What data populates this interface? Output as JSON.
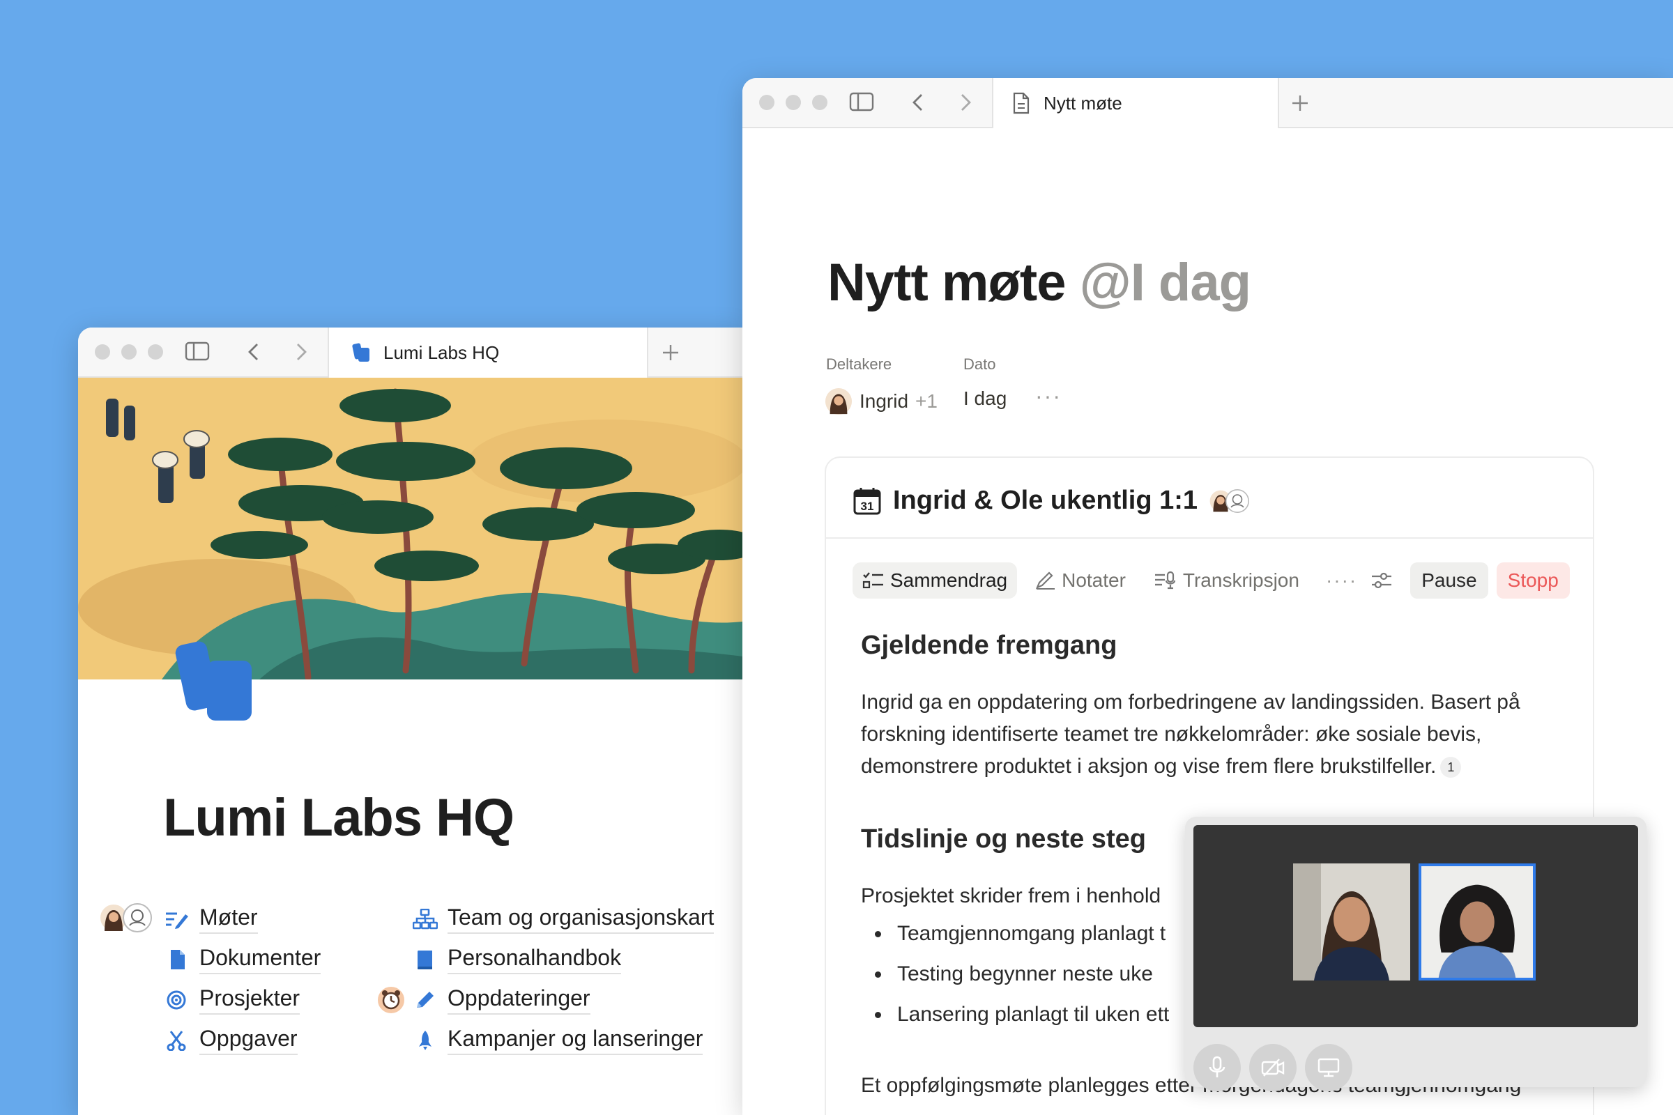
{
  "colors": {
    "background": "#66a9ec",
    "accent_blue": "#3478d6",
    "stop_red": "#eb5757"
  },
  "left_window": {
    "tab_title": "Lumi Labs HQ",
    "page_title": "Lumi Labs HQ",
    "nav": [
      {
        "label": "Møter",
        "icon": "meeting-notes-icon"
      },
      {
        "label": "Dokumenter",
        "icon": "document-icon"
      },
      {
        "label": "Prosjekter",
        "icon": "target-icon"
      },
      {
        "label": "Oppgaver",
        "icon": "scissors-icon"
      },
      {
        "label": "Team og organisasjonskart",
        "icon": "org-chart-icon"
      },
      {
        "label": "Personalhandbok",
        "icon": "book-icon"
      },
      {
        "label": "Oppdateringer",
        "icon": "pencil-icon"
      },
      {
        "label": "Kampanjer og lanseringer",
        "icon": "rocket-icon"
      }
    ]
  },
  "right_window": {
    "tab_title": "Nytt møte",
    "title_main": "Nytt møte",
    "title_mention": "@I dag",
    "props": {
      "participants_label": "Deltakere",
      "participant_name": "Ingrid",
      "participant_extra": "+1",
      "date_label": "Dato",
      "date_value": "I dag",
      "more": "···"
    },
    "card": {
      "title": "Ingrid & Ole ukentlig 1:1",
      "calendar_day": "31",
      "tabs": {
        "summary": "Sammendrag",
        "notes": "Notater",
        "transcript": "Transkripsjon"
      },
      "more": "····",
      "pause": "Pause",
      "stop": "Stopp",
      "heading1": "Gjeldende fremgang",
      "paragraph1": "Ingrid ga en oppdatering om forbedringene av landingssiden. Basert på forskning identifiserte teamet tre nøkkelområder: øke sosiale bevis, demonstrere produktet i aksjon og vise frem flere brukstilfeller.",
      "footnote": "1",
      "heading2": "Tidslinje og neste steg",
      "paragraph2": "Prosjektet skrider frem i henhold",
      "bullets": [
        "Teamgjennomgang planlagt t",
        "Testing begynner neste uke",
        "Lansering planlagt til uken ett"
      ],
      "paragraph3": "Et oppfølgingsmøte planlegges etter morgendagens teamgjennomgang"
    }
  }
}
